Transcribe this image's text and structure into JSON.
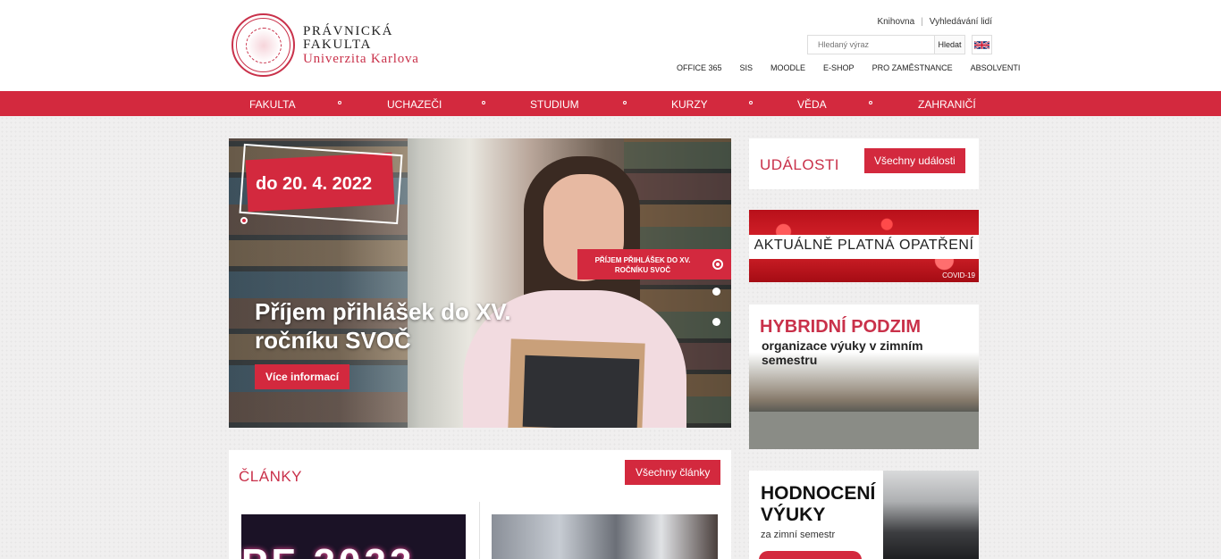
{
  "logo": {
    "line1": "PRÁVNICKÁ",
    "line2": "FAKULTA",
    "line3": "Univerzita Karlova"
  },
  "toplinks": [
    "Knihovna",
    "Vyhledávání lidí"
  ],
  "search": {
    "placeholder": "Hledaný výraz",
    "button": "Hledat"
  },
  "language_flag": "uk-flag-icon",
  "quicklinks": [
    "OFFICE 365",
    "SIS",
    "MOODLE",
    "E-SHOP",
    "PRO ZAMĚSTNANCE",
    "ABSOLVENTI"
  ],
  "mainnav": [
    "FAKULTA",
    "UCHAZEČI",
    "STUDIUM",
    "KURZY",
    "VĚDA",
    "ZAHRANIČÍ"
  ],
  "slider": {
    "date": "do 20. 4. 2022",
    "title": "Příjem přihlášek do XV. ročníku SVOČ",
    "button": "Více informací",
    "tab_line1": "PŘÍJEM PŘIHLÁŠEK DO XV.",
    "tab_line2": "ROČNÍKU SVOČ"
  },
  "events": {
    "heading": "UDÁLOSTI",
    "button": "Všechny události"
  },
  "banner_covid": {
    "title": "AKTUÁLNĚ PLATNÁ OPATŘENÍ",
    "tag": "COVID-19"
  },
  "banner_hybrid": {
    "title": "HYBRIDNÍ PODZIM",
    "subtitle": "organizace výuky v zimním semestru"
  },
  "banner_survey": {
    "line1": "HODNOCENÍ",
    "line2": "VÝUKY",
    "subtitle": "za zimní semestr"
  },
  "articles": {
    "heading": "ČLÁNKY",
    "button": "Všechny články",
    "image1_text": "PF 2022"
  },
  "colors": {
    "accent": "#d3293e",
    "brand_text": "#c9314a"
  }
}
